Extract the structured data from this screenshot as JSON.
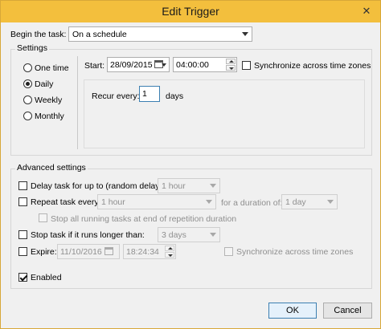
{
  "window": {
    "title": "Edit Trigger"
  },
  "begin_task": {
    "label": "Begin the task:",
    "value": "On a schedule"
  },
  "settings": {
    "group_label": "Settings",
    "radios": [
      {
        "label": "One time",
        "checked": false
      },
      {
        "label": "Daily",
        "checked": true
      },
      {
        "label": "Weekly",
        "checked": false
      },
      {
        "label": "Monthly",
        "checked": false
      }
    ],
    "start_label": "Start:",
    "start_date": "28/09/2015",
    "start_time": "04:00:00",
    "sync_label": "Synchronize across time zones",
    "recur_label": "Recur every:",
    "recur_value": "1",
    "recur_unit": "days"
  },
  "advanced": {
    "group_label": "Advanced settings",
    "delay_label": "Delay task for up to (random delay):",
    "delay_value": "1 hour",
    "repeat_label": "Repeat task every:",
    "repeat_value": "1 hour",
    "duration_label": "for a duration of:",
    "duration_value": "1 day",
    "stop_running_label": "Stop all running tasks at end of repetition duration",
    "stop_longer_label": "Stop task if it runs longer than:",
    "stop_longer_value": "3 days",
    "expire_label": "Expire:",
    "expire_date": "11/10/2016",
    "expire_time": "18:24:34",
    "expire_sync_label": "Synchronize across time zones",
    "enabled_label": "Enabled",
    "enabled_checked": true
  },
  "buttons": {
    "ok": "OK",
    "cancel": "Cancel"
  },
  "icons": {
    "close": "close-icon",
    "dropdown": "chevron-down-icon",
    "calendar": "calendar-icon"
  },
  "colors": {
    "titlebar": "#f3bf3d",
    "window_bg": "#f0f0f0",
    "focus_border": "#3c7fb1"
  }
}
